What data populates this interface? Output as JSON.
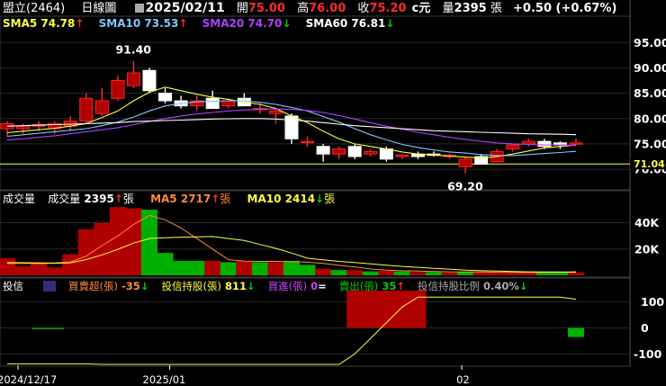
{
  "header": {
    "stock": "盟立(2464)",
    "chart_type": "日線圖",
    "date": "2025/02/11",
    "open_label": "開",
    "open": "75.00",
    "high_label": "高",
    "high": "76.00",
    "close_label": "收",
    "close": "75.20",
    "currency": "c元",
    "vol_label": "量",
    "volume": "2395",
    "vol_unit": "張",
    "change": "+0.50 (+0.67%)"
  },
  "price_legend": {
    "sma5": {
      "label": "SMA5",
      "value": "74.78",
      "arrow": "↑",
      "color": "#ffff3c"
    },
    "sma10": {
      "label": "SMA10",
      "value": "73.53",
      "arrow": "↑",
      "color": "#7ec8ff"
    },
    "sma20": {
      "label": "SMA20",
      "value": "74.70",
      "arrow": "↓",
      "color": "#b040ff"
    },
    "sma60": {
      "label": "SMA60",
      "value": "76.81",
      "arrow": "↓",
      "color": "#ffffff"
    }
  },
  "volume_legend": {
    "title": "成交量",
    "vol": {
      "label": "成交量",
      "value": "2395",
      "arrow": "↑",
      "unit": "張"
    },
    "ma5": {
      "label": "MA5",
      "value": "2717",
      "arrow": "↑",
      "unit": "張",
      "color": "#ff8a3c"
    },
    "ma10": {
      "label": "MA10",
      "value": "2414",
      "arrow": "↓",
      "unit": "張",
      "color": "#ffff3c"
    }
  },
  "trust_legend": {
    "title": "投信",
    "net": {
      "label": "買賣超(張)",
      "value": "-35",
      "arrow": "↓"
    },
    "hold": {
      "label": "投信持股(張)",
      "value": "811",
      "arrow": "↓"
    },
    "buy": {
      "label": "買進(張)",
      "value": "0",
      "arrow": "="
    },
    "sell": {
      "label": "賣出(張)",
      "value": "35",
      "arrow": "↑"
    },
    "ratio": {
      "label": "投信持股比例",
      "value": "0.40%",
      "arrow": "↓"
    }
  },
  "annotations": {
    "high_label": "91.40",
    "low_label": "69.20",
    "last_line_label": "71.04"
  },
  "x_labels": [
    "2024/12/17",
    "2025/01",
    "02"
  ],
  "colors": {
    "up": "#ff2020",
    "down": "#00c000",
    "bg": "#000000",
    "grid": "#333333"
  },
  "chart_data": [
    {
      "type": "candlestick",
      "title": "日線圖",
      "ylim": [
        67,
        97
      ],
      "yticks": [
        70,
        75,
        80,
        85,
        90,
        95
      ],
      "horizontal_line": 71.04,
      "candles": [
        {
          "o": 78.0,
          "h": 79.5,
          "l": 76.5,
          "c": 79.0
        },
        {
          "o": 78.0,
          "h": 79.0,
          "l": 77.0,
          "c": 78.5
        },
        {
          "o": 78.5,
          "h": 79.5,
          "l": 77.5,
          "c": 78.8
        },
        {
          "o": 78.0,
          "h": 79.5,
          "l": 77.0,
          "c": 79.0
        },
        {
          "o": 78.5,
          "h": 80.5,
          "l": 77.5,
          "c": 79.5
        },
        {
          "o": 79.5,
          "h": 85.0,
          "l": 79.0,
          "c": 84.0
        },
        {
          "o": 81.0,
          "h": 86.0,
          "l": 80.5,
          "c": 83.5
        },
        {
          "o": 84.0,
          "h": 88.5,
          "l": 83.5,
          "c": 87.5
        },
        {
          "o": 86.5,
          "h": 91.4,
          "l": 86.0,
          "c": 89.0
        },
        {
          "o": 89.5,
          "h": 90.0,
          "l": 85.0,
          "c": 85.5
        },
        {
          "o": 85.0,
          "h": 86.0,
          "l": 83.0,
          "c": 83.5
        },
        {
          "o": 83.5,
          "h": 84.5,
          "l": 82.0,
          "c": 82.5
        },
        {
          "o": 82.5,
          "h": 84.5,
          "l": 81.5,
          "c": 83.5
        },
        {
          "o": 84.0,
          "h": 85.5,
          "l": 82.0,
          "c": 82.0
        },
        {
          "o": 82.5,
          "h": 84.0,
          "l": 82.0,
          "c": 83.5
        },
        {
          "o": 84.0,
          "h": 85.0,
          "l": 82.5,
          "c": 82.5
        },
        {
          "o": 82.0,
          "h": 83.0,
          "l": 81.0,
          "c": 82.0
        },
        {
          "o": 81.0,
          "h": 82.0,
          "l": 79.0,
          "c": 81.5
        },
        {
          "o": 80.5,
          "h": 81.0,
          "l": 75.0,
          "c": 76.0
        },
        {
          "o": 75.5,
          "h": 76.5,
          "l": 74.5,
          "c": 75.5
        },
        {
          "o": 74.5,
          "h": 75.0,
          "l": 71.5,
          "c": 73.0
        },
        {
          "o": 73.0,
          "h": 74.5,
          "l": 72.0,
          "c": 74.0
        },
        {
          "o": 74.5,
          "h": 75.0,
          "l": 72.0,
          "c": 72.5
        },
        {
          "o": 73.0,
          "h": 74.0,
          "l": 72.5,
          "c": 73.5
        },
        {
          "o": 74.0,
          "h": 74.5,
          "l": 71.5,
          "c": 72.0
        },
        {
          "o": 72.5,
          "h": 73.0,
          "l": 72.0,
          "c": 72.8
        },
        {
          "o": 73.0,
          "h": 73.5,
          "l": 72.0,
          "c": 72.5
        },
        {
          "o": 73.0,
          "h": 73.5,
          "l": 72.5,
          "c": 72.8
        },
        {
          "o": 72.5,
          "h": 73.0,
          "l": 72.0,
          "c": 72.8
        },
        {
          "o": 70.5,
          "h": 72.5,
          "l": 69.2,
          "c": 72.0
        },
        {
          "o": 72.5,
          "h": 73.0,
          "l": 71.0,
          "c": 71.0
        },
        {
          "o": 71.5,
          "h": 74.0,
          "l": 71.5,
          "c": 73.5
        },
        {
          "o": 74.0,
          "h": 75.0,
          "l": 73.5,
          "c": 74.8
        },
        {
          "o": 75.0,
          "h": 76.0,
          "l": 74.5,
          "c": 75.5
        },
        {
          "o": 75.5,
          "h": 76.0,
          "l": 74.0,
          "c": 74.5
        },
        {
          "o": 75.2,
          "h": 75.5,
          "l": 74.0,
          "c": 75.0
        },
        {
          "o": 75.0,
          "h": 76.0,
          "l": 74.8,
          "c": 75.2
        }
      ],
      "series": [
        {
          "name": "SMA5",
          "color": "#ffff3c",
          "values": [
            77.2,
            77.5,
            77.8,
            78.1,
            78.5,
            79.0,
            80.2,
            81.5,
            83.5,
            85.2,
            86.2,
            85.5,
            84.8,
            84.2,
            83.8,
            83.2,
            82.8,
            82.0,
            80.5,
            79.2,
            77.5,
            76.0,
            75.0,
            74.5,
            74.0,
            73.4,
            73.0,
            72.8,
            72.6,
            72.4,
            72.2,
            72.5,
            73.0,
            73.6,
            74.2,
            74.5,
            74.78
          ]
        },
        {
          "name": "SMA10",
          "color": "#7ec8ff",
          "values": [
            76.5,
            76.8,
            77.1,
            77.4,
            77.7,
            78.0,
            78.6,
            79.3,
            80.3,
            81.5,
            82.5,
            83.0,
            83.3,
            83.4,
            83.5,
            83.5,
            83.2,
            82.8,
            82.2,
            81.5,
            80.4,
            79.3,
            78.0,
            76.8,
            75.8,
            74.9,
            74.3,
            73.8,
            73.4,
            73.2,
            72.9,
            72.7,
            72.7,
            72.9,
            73.1,
            73.3,
            73.53
          ]
        },
        {
          "name": "SMA20",
          "color": "#b040ff",
          "values": [
            75.8,
            76.0,
            76.3,
            76.6,
            77.0,
            77.4,
            77.8,
            78.2,
            78.8,
            79.4,
            80.0,
            80.5,
            80.9,
            81.2,
            81.5,
            81.7,
            81.8,
            81.9,
            81.8,
            81.6,
            81.2,
            80.6,
            79.9,
            79.2,
            78.5,
            77.9,
            77.3,
            76.8,
            76.3,
            75.9,
            75.5,
            75.2,
            75.0,
            74.9,
            74.8,
            74.75,
            74.7
          ]
        },
        {
          "name": "SMA60",
          "color": "#ffffff",
          "values": [
            78.5,
            78.6,
            78.7,
            78.8,
            78.9,
            79.0,
            79.1,
            79.2,
            79.4,
            79.5,
            79.6,
            79.7,
            79.8,
            79.9,
            79.95,
            80.0,
            80.0,
            79.9,
            79.7,
            79.5,
            79.2,
            78.9,
            78.6,
            78.4,
            78.2,
            78.0,
            77.8,
            77.6,
            77.5,
            77.4,
            77.3,
            77.2,
            77.1,
            77.0,
            76.95,
            76.9,
            76.81
          ]
        }
      ]
    },
    {
      "type": "bar",
      "title": "成交量",
      "ylabel": "張",
      "ylim": [
        0,
        52000
      ],
      "yticks": [
        20000,
        40000
      ],
      "ytick_labels": [
        "20K",
        "40K"
      ],
      "values": [
        13000,
        7000,
        9000,
        6000,
        16000,
        35000,
        40000,
        52000,
        51000,
        50000,
        17000,
        11000,
        11000,
        11000,
        10000,
        11000,
        10000,
        10000,
        11000,
        8000,
        5000,
        4000,
        4000,
        3000,
        3500,
        3000,
        2500,
        2500,
        2000,
        2500,
        2200,
        2000,
        2000,
        2200,
        2000,
        2500,
        2395
      ],
      "up": [
        true,
        true,
        true,
        true,
        true,
        true,
        true,
        true,
        true,
        false,
        false,
        false,
        false,
        true,
        false,
        true,
        false,
        true,
        false,
        false,
        true,
        false,
        true,
        false,
        true,
        false,
        true,
        false,
        true,
        false,
        true,
        true,
        true,
        true,
        false,
        false,
        true
      ],
      "series": [
        {
          "name": "MA5",
          "color": "#ff8a3c",
          "values": [
            10000,
            9800,
            9600,
            9400,
            10200,
            14600,
            22600,
            30000,
            38600,
            45600,
            42200,
            36000,
            28000,
            20000,
            12000,
            10800,
            10600,
            10600,
            10400,
            10000,
            9000,
            7600,
            6400,
            4800,
            4000,
            3500,
            3300,
            2900,
            2700,
            2500,
            2500,
            2300,
            2200,
            2200,
            2200,
            2300,
            2717
          ]
        },
        {
          "name": "MA10",
          "color": "#ffff3c",
          "values": [
            9000,
            9000,
            9100,
            9200,
            9500,
            12000,
            15500,
            19800,
            24500,
            28000,
            28500,
            29000,
            29300,
            29500,
            28000,
            26500,
            23500,
            20500,
            17000,
            13000,
            11800,
            10600,
            9700,
            8700,
            7700,
            6800,
            6100,
            5300,
            4700,
            4000,
            3500,
            3200,
            2900,
            2700,
            2600,
            2500,
            2414
          ]
        }
      ]
    },
    {
      "type": "bar",
      "title": "投信",
      "ylabel": "張",
      "ylim": [
        -140,
        160
      ],
      "yticks": [
        -100,
        0,
        100
      ],
      "values": [
        0,
        0,
        0,
        0,
        0,
        0,
        0,
        0,
        0,
        0,
        0,
        0,
        0,
        0,
        0,
        0,
        0,
        0,
        0,
        0,
        0,
        0,
        0,
        0,
        0,
        0,
        0,
        0,
        0,
        0,
        0,
        0,
        0,
        0,
        0,
        0,
        -35
      ],
      "extra_bars": [
        {
          "index": 1,
          "value": -5
        },
        {
          "index": 2,
          "value": -5
        }
      ],
      "up_block": {
        "start": 22,
        "end": 26,
        "value": 143
      },
      "series": [
        {
          "name": "投信持股(張)",
          "color": "#ffff3c",
          "values": [
            -138,
            -138,
            -138,
            -138,
            -138,
            -138,
            -140,
            -140,
            -140,
            -140,
            -140,
            -140,
            -140,
            -140,
            -140,
            -140,
            -140,
            -140,
            -140,
            -140,
            -140,
            -140,
            -100,
            -40,
            20,
            80,
            118,
            118,
            118,
            118,
            118,
            118,
            118,
            118,
            118,
            118,
            110
          ]
        }
      ]
    }
  ]
}
